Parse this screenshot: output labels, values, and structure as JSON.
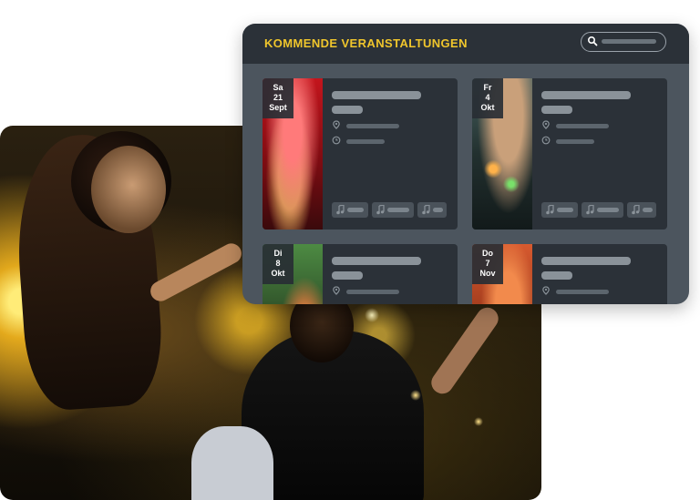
{
  "widget": {
    "title": "KOMMENDE VERANSTALTUNGEN"
  },
  "events": [
    {
      "weekday": "Sa",
      "day": "21",
      "month": "Sept"
    },
    {
      "weekday": "Fr",
      "day": "4",
      "month": "Okt"
    },
    {
      "weekday": "Di",
      "day": "8",
      "month": "Okt"
    },
    {
      "weekday": "Do",
      "day": "7",
      "month": "Nov"
    }
  ],
  "colors": {
    "accent": "#f0c62c",
    "panel": "#2b3138",
    "widget_bg": "#4c555e"
  },
  "icons": [
    "search-icon",
    "location-pin-icon",
    "clock-icon",
    "music-note-icon"
  ]
}
